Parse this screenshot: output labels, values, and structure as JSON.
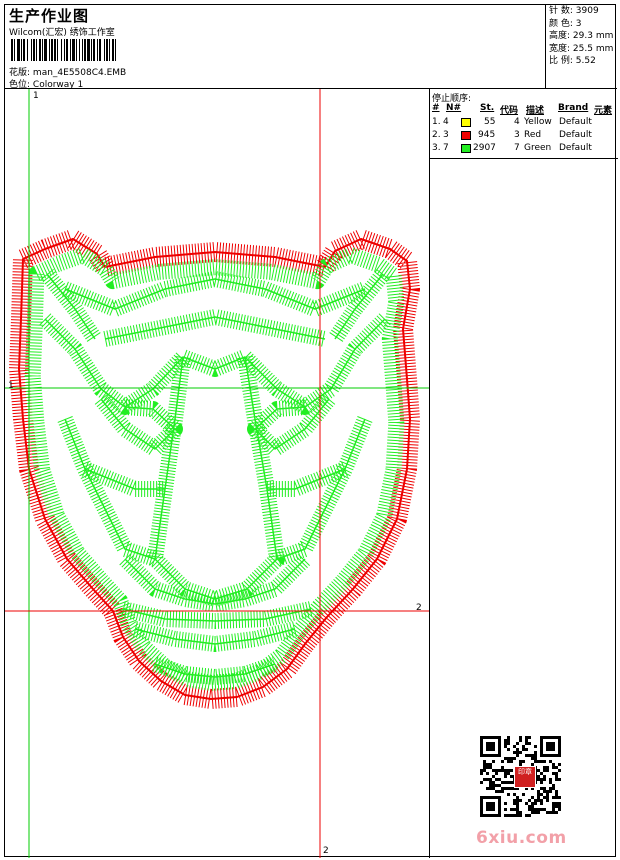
{
  "header": {
    "title": "生产作业图",
    "company": "Wilcom(汇宏) 绣饰工作室",
    "design_label": "花版:",
    "design_value": "man_4E5508C4.EMB",
    "colorway_label": "色位:",
    "colorway_value": "Colorway 1"
  },
  "stats": [
    {
      "label": "针 数:",
      "value": "3909"
    },
    {
      "label": "颜 色:",
      "value": "3"
    },
    {
      "label": "高度:",
      "value": "29.3 mm"
    },
    {
      "label": "宽度:",
      "value": "25.5 mm"
    },
    {
      "label": "比 例:",
      "value": "5.52"
    }
  ],
  "stop_sequence": {
    "title": "停止顺序:",
    "columns": [
      "#",
      "N#",
      "St.",
      "代码",
      "描述",
      "Brand",
      "元素"
    ],
    "rows": [
      {
        "index": "1.",
        "n": "4",
        "color": "#ffff00",
        "stitches": "55",
        "code": "4",
        "description": "Yellow",
        "brand": "Default"
      },
      {
        "index": "2.",
        "n": "3",
        "color": "#ee0000",
        "stitches": "945",
        "code": "3",
        "description": "Red",
        "brand": "Default"
      },
      {
        "index": "3.",
        "n": "7",
        "color": "#22ee22",
        "stitches": "2907",
        "code": "7",
        "description": "Green",
        "brand": "Default"
      }
    ]
  },
  "guides": {
    "v1_label": "1",
    "h1_label": "1",
    "h2_label": "2",
    "v2_label": "2"
  },
  "design_colors": {
    "outline": "#ee0000",
    "fill": "#22ee22",
    "guide_green": "#00cc00",
    "guide_red": "#ee0000"
  },
  "qr": {
    "seal_text": "印章"
  },
  "watermark": "6xiu.com"
}
